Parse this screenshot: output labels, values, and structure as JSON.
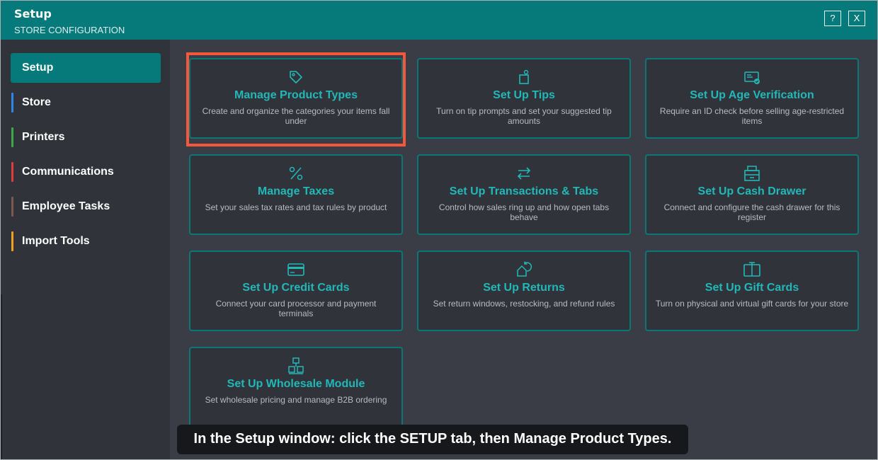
{
  "window": {
    "title": "Setup",
    "subtitle": "STORE CONFIGURATION",
    "help_label": "?",
    "close_label": "X"
  },
  "sidebar": {
    "items": [
      {
        "label": "Setup",
        "active": true,
        "color": "#067a7a"
      },
      {
        "label": "Store",
        "color": "#2f86e6"
      },
      {
        "label": "Printers",
        "color": "#3fa94a"
      },
      {
        "label": "Communications",
        "color": "#e23b3b"
      },
      {
        "label": "Employee Tasks",
        "color": "#7a5a4e"
      },
      {
        "label": "Import Tools",
        "color": "#f0a020"
      }
    ]
  },
  "cards": [
    {
      "title": "Manage Product Types",
      "desc": "Create and organize the categories your items fall under",
      "icon": "tag-icon"
    },
    {
      "title": "Set Up Tips",
      "desc": "Turn on tip prompts and set your suggested tip amounts",
      "icon": "tip-jar-icon"
    },
    {
      "title": "Set Up Age Verification",
      "desc": "Require an ID check before selling age-restricted items",
      "icon": "id-card-icon"
    },
    {
      "title": "Manage Taxes",
      "desc": "Set your sales tax rates and tax rules by product",
      "icon": "percent-icon"
    },
    {
      "title": "Set Up Transactions & Tabs",
      "desc": "Control how sales ring up and how open tabs behave",
      "icon": "swap-arrows-icon"
    },
    {
      "title": "Set Up Cash Drawer",
      "desc": "Connect and configure the cash drawer for this register",
      "icon": "cash-drawer-icon"
    },
    {
      "title": "Set Up Credit Cards",
      "desc": "Connect your card processor and payment terminals",
      "icon": "credit-card-icon"
    },
    {
      "title": "Set Up Returns",
      "desc": "Set return windows, restocking, and refund rules",
      "icon": "return-icon"
    },
    {
      "title": "Set Up Gift Cards",
      "desc": "Turn on physical and virtual gift cards for your store",
      "icon": "gift-card-icon"
    },
    {
      "title": "Set Up Wholesale Module",
      "desc": "Set wholesale pricing and manage B2B ordering",
      "icon": "wholesale-boxes-icon"
    }
  ],
  "caption": "In the Setup window: click the SETUP tab, then Manage Product Types.",
  "colors": {
    "accent": "#067a7a",
    "card_title": "#22b8b8",
    "highlight": "#f2583a"
  }
}
